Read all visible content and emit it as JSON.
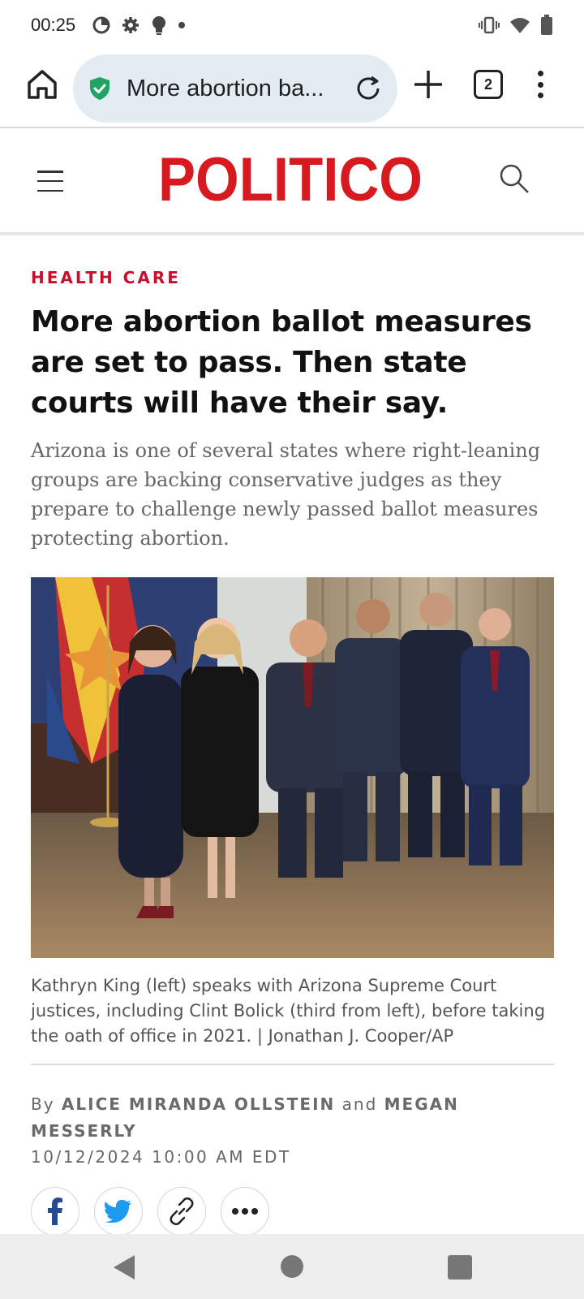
{
  "status_bar": {
    "time": "00:25",
    "left_icons": [
      "data-saver-icon",
      "settings-icon",
      "lightbulb-icon",
      "dot-icon"
    ],
    "right_icons": [
      "vibrate-icon",
      "wifi-icon",
      "battery-icon"
    ]
  },
  "browser": {
    "url_display": "More abortion ba...",
    "tab_count": "2",
    "secure_color": "#1fa463"
  },
  "site": {
    "logo_text": "POLITICO",
    "brand_color": "#d71920"
  },
  "article": {
    "kicker": "HEALTH CARE",
    "headline": "More abortion ballot measures are set to pass. Then state courts will have their say.",
    "dek": "Arizona is one of several states where right-leaning groups are backing conservative judges as they prepare to challenge newly passed ballot measures protecting abortion.",
    "caption": "Kathryn King (left) speaks with Arizona Supreme Court justices, including Clint Bolick (third from left), before taking the oath of office in 2021. | Jonathan J. Cooper/AP",
    "byline_prefix": "By",
    "author_1": "ALICE MIRANDA OLLSTEIN",
    "byline_conj": "and",
    "author_2": "MEGAN MESSERLY",
    "date": "10/12/2024 10:00 AM EDT"
  },
  "share": {
    "buttons": [
      "facebook-icon",
      "twitter-icon",
      "link-icon",
      "more-icon"
    ]
  }
}
